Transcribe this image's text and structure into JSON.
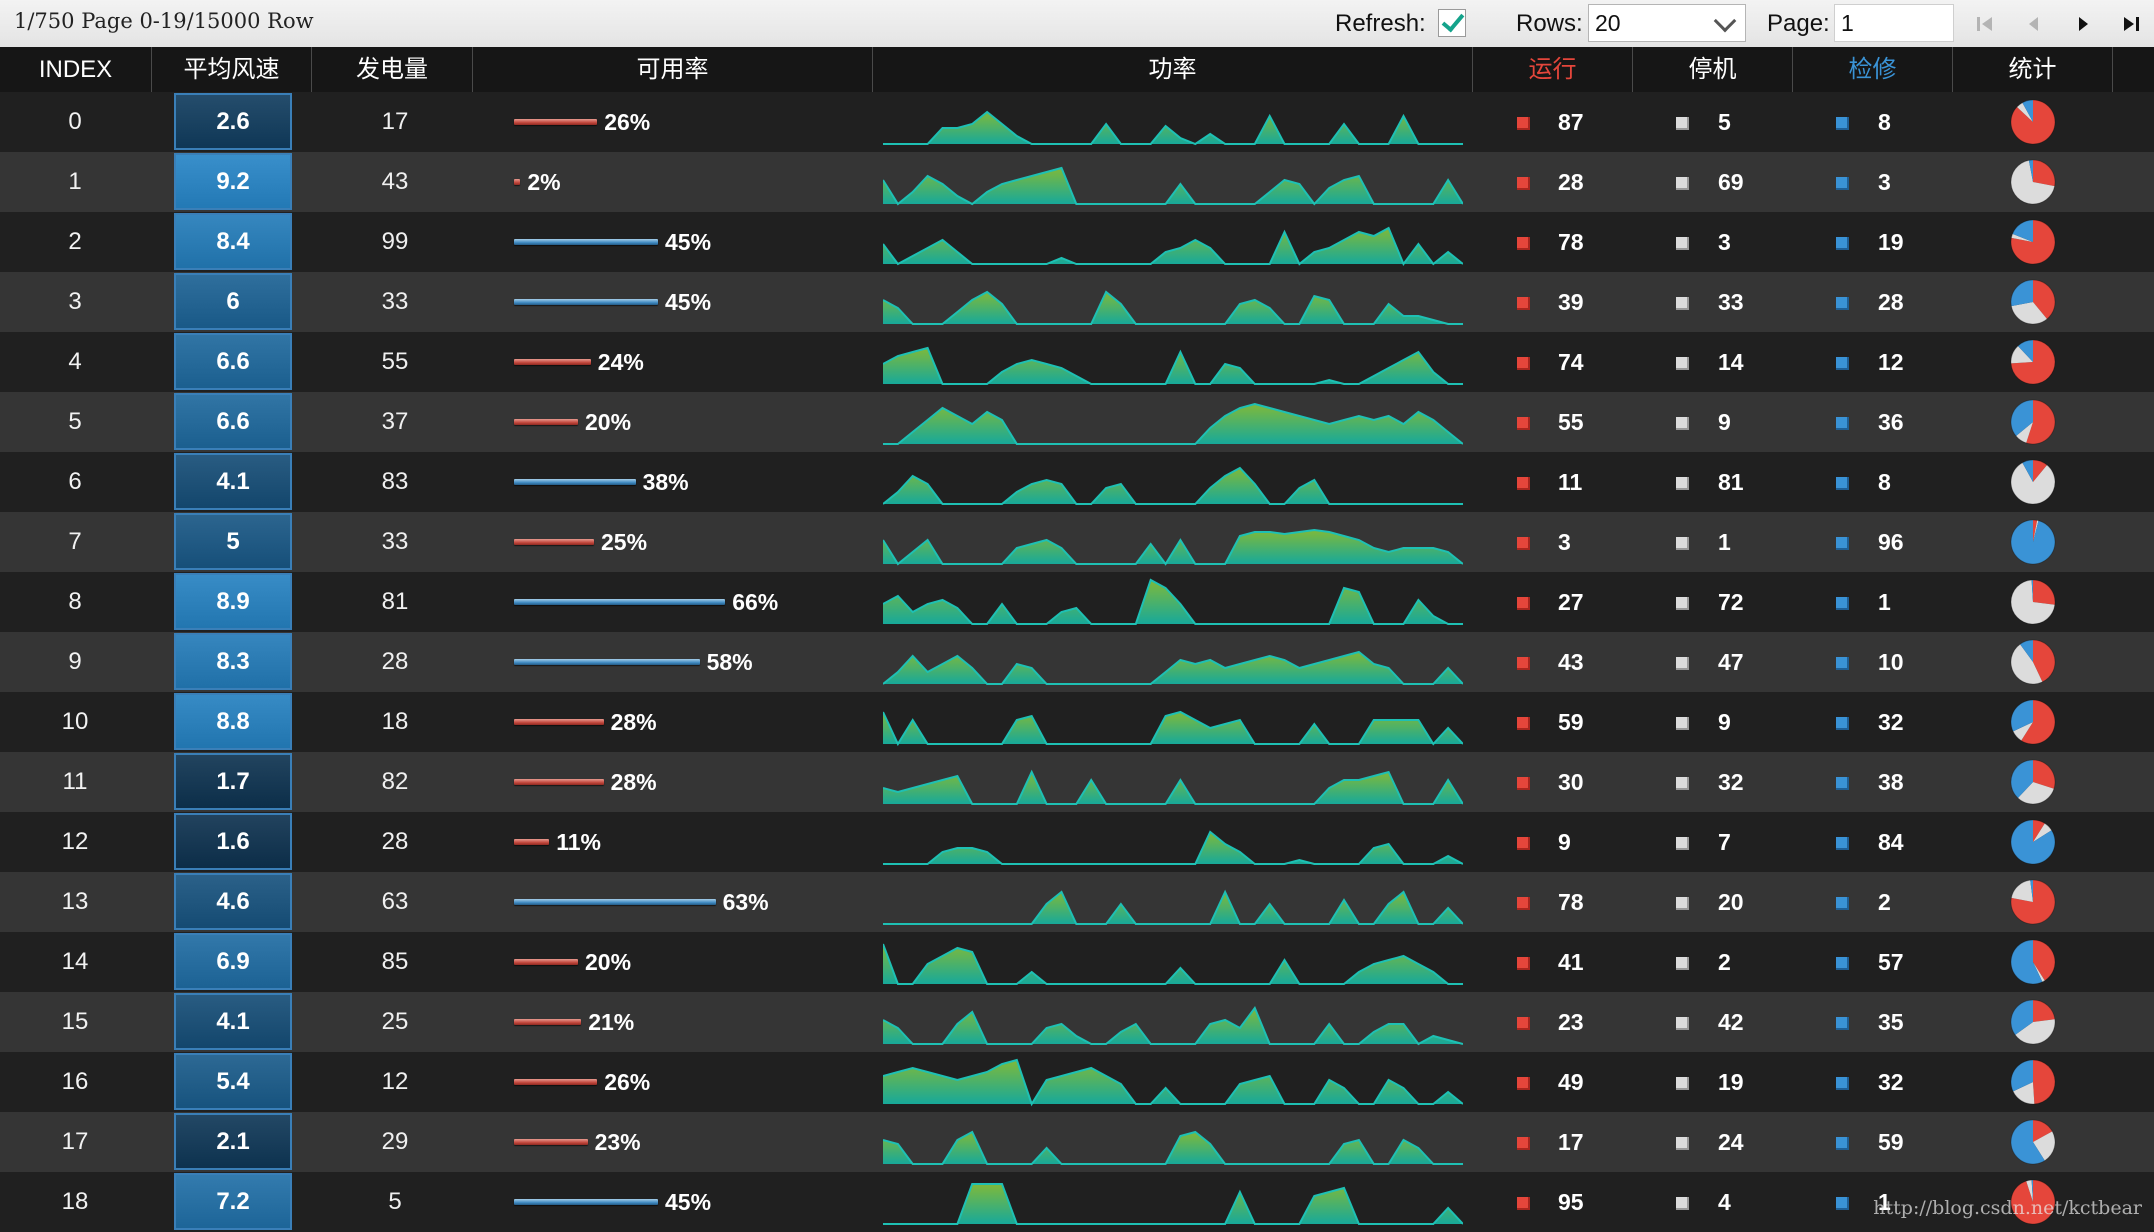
{
  "toolbar": {
    "status": "1/750 Page 0-19/15000 Row",
    "refresh_label": "Refresh:",
    "refresh_checked": true,
    "rows_label": "Rows:",
    "rows_value": "20",
    "page_label": "Page:",
    "page_value": "1",
    "nav_icons": [
      "first-page-icon",
      "previous-page-icon",
      "next-page-icon",
      "last-page-icon"
    ]
  },
  "columns": [
    "INDEX",
    "平均风速",
    "发电量",
    "可用率",
    "功率",
    "运行",
    "停机",
    "检修",
    "统计"
  ],
  "colors": {
    "run": "#e5463b",
    "stop": "#dcdcdc",
    "repair": "#3a93d6",
    "header_run": "#e5463b",
    "header_repair": "#3a93d6",
    "bar_red": "#c2473c",
    "bar_blue": "#3f8ac2",
    "spark_green": "#7fb93a",
    "spark_teal": "#17a99a",
    "wind_dark": "#1d3347",
    "wind_light": "#3b97d6"
  },
  "rows": [
    {
      "index": "0",
      "wind": "2.6",
      "power": "17",
      "avail": 26,
      "avail_color": "red",
      "run": "87",
      "stop": "5",
      "repair": "8",
      "spark": [
        0,
        0,
        0,
        0,
        8,
        8,
        10,
        16,
        10,
        4,
        0,
        0,
        0,
        0,
        0,
        10,
        0,
        0,
        0,
        9,
        3,
        0,
        5,
        0,
        0,
        0,
        14,
        0,
        0,
        0,
        0,
        10,
        0,
        0,
        0,
        14,
        0,
        0,
        0,
        0
      ]
    },
    {
      "index": "1",
      "wind": "9.2",
      "power": "43",
      "avail": 2,
      "avail_color": "red",
      "run": "28",
      "stop": "69",
      "repair": "3",
      "spark": [
        12,
        0,
        6,
        14,
        10,
        4,
        0,
        6,
        10,
        12,
        14,
        16,
        18,
        0,
        0,
        0,
        0,
        0,
        0,
        0,
        10,
        0,
        0,
        0,
        0,
        0,
        6,
        12,
        10,
        0,
        8,
        12,
        14,
        0,
        0,
        0,
        0,
        0,
        12,
        0
      ]
    },
    {
      "index": "2",
      "wind": "8.4",
      "power": "99",
      "avail": 45,
      "avail_color": "blue",
      "run": "78",
      "stop": "3",
      "repair": "19",
      "spark": [
        10,
        0,
        4,
        8,
        12,
        6,
        0,
        0,
        0,
        0,
        0,
        0,
        3,
        0,
        0,
        0,
        0,
        0,
        0,
        6,
        8,
        12,
        8,
        0,
        0,
        0,
        0,
        16,
        0,
        6,
        8,
        12,
        16,
        14,
        18,
        0,
        10,
        0,
        6,
        0
      ]
    },
    {
      "index": "3",
      "wind": "6",
      "power": "33",
      "avail": 45,
      "avail_color": "blue",
      "run": "39",
      "stop": "33",
      "repair": "28",
      "spark": [
        12,
        8,
        0,
        0,
        0,
        6,
        12,
        16,
        10,
        0,
        0,
        0,
        0,
        0,
        0,
        16,
        10,
        0,
        0,
        0,
        0,
        0,
        0,
        0,
        10,
        12,
        8,
        0,
        0,
        14,
        12,
        0,
        0,
        0,
        10,
        4,
        4,
        2,
        0,
        0
      ]
    },
    {
      "index": "4",
      "wind": "6.6",
      "power": "55",
      "avail": 24,
      "avail_color": "red",
      "run": "74",
      "stop": "14",
      "repair": "12",
      "spark": [
        10,
        14,
        16,
        18,
        0,
        0,
        0,
        0,
        6,
        10,
        12,
        10,
        8,
        4,
        0,
        0,
        0,
        0,
        0,
        0,
        16,
        0,
        0,
        10,
        8,
        0,
        0,
        0,
        0,
        0,
        2,
        0,
        0,
        4,
        8,
        12,
        16,
        6,
        0,
        0
      ]
    },
    {
      "index": "5",
      "wind": "6.6",
      "power": "37",
      "avail": 20,
      "avail_color": "red",
      "run": "55",
      "stop": "9",
      "repair": "36",
      "spark": [
        0,
        0,
        6,
        12,
        18,
        14,
        10,
        16,
        12,
        0,
        0,
        0,
        0,
        0,
        0,
        0,
        0,
        0,
        0,
        0,
        0,
        0,
        8,
        14,
        18,
        20,
        18,
        16,
        14,
        12,
        10,
        12,
        14,
        12,
        14,
        10,
        16,
        12,
        6,
        0
      ]
    },
    {
      "index": "6",
      "wind": "4.1",
      "power": "83",
      "avail": 38,
      "avail_color": "blue",
      "run": "11",
      "stop": "81",
      "repair": "8",
      "spark": [
        0,
        6,
        14,
        10,
        0,
        0,
        0,
        0,
        0,
        6,
        10,
        12,
        10,
        0,
        0,
        8,
        10,
        0,
        0,
        0,
        0,
        0,
        8,
        14,
        18,
        10,
        0,
        0,
        8,
        12,
        0,
        0,
        0,
        0,
        0,
        0,
        0,
        0,
        0,
        0
      ]
    },
    {
      "index": "7",
      "wind": "5",
      "power": "33",
      "avail": 25,
      "avail_color": "red",
      "run": "3",
      "stop": "1",
      "repair": "96",
      "spark": [
        12,
        0,
        6,
        12,
        0,
        0,
        0,
        0,
        0,
        8,
        10,
        12,
        8,
        0,
        0,
        0,
        0,
        0,
        10,
        0,
        12,
        0,
        0,
        0,
        14,
        16,
        16,
        15,
        16,
        17,
        16,
        14,
        12,
        8,
        6,
        8,
        8,
        8,
        6,
        0
      ]
    },
    {
      "index": "8",
      "wind": "8.9",
      "power": "81",
      "avail": 66,
      "avail_color": "blue",
      "run": "27",
      "stop": "72",
      "repair": "1",
      "spark": [
        10,
        14,
        6,
        10,
        12,
        8,
        0,
        0,
        10,
        0,
        0,
        0,
        6,
        8,
        0,
        0,
        0,
        0,
        22,
        18,
        10,
        0,
        0,
        0,
        0,
        0,
        0,
        0,
        0,
        0,
        0,
        18,
        16,
        0,
        0,
        0,
        12,
        4,
        0,
        0
      ]
    },
    {
      "index": "9",
      "wind": "8.3",
      "power": "28",
      "avail": 58,
      "avail_color": "blue",
      "run": "43",
      "stop": "47",
      "repair": "10",
      "spark": [
        0,
        6,
        14,
        6,
        10,
        14,
        8,
        0,
        0,
        10,
        8,
        0,
        0,
        0,
        0,
        0,
        0,
        0,
        0,
        6,
        12,
        10,
        12,
        8,
        10,
        12,
        14,
        12,
        8,
        10,
        12,
        14,
        16,
        10,
        8,
        0,
        0,
        0,
        8,
        0
      ]
    },
    {
      "index": "10",
      "wind": "8.8",
      "power": "18",
      "avail": 28,
      "avail_color": "red",
      "run": "59",
      "stop": "9",
      "repair": "32",
      "spark": [
        16,
        0,
        12,
        0,
        0,
        0,
        0,
        0,
        0,
        12,
        14,
        0,
        0,
        0,
        0,
        0,
        0,
        0,
        0,
        14,
        16,
        12,
        8,
        10,
        12,
        0,
        0,
        0,
        0,
        10,
        0,
        0,
        0,
        12,
        12,
        12,
        12,
        0,
        8,
        0
      ]
    },
    {
      "index": "11",
      "wind": "1.7",
      "power": "82",
      "avail": 28,
      "avail_color": "red",
      "run": "30",
      "stop": "32",
      "repair": "38",
      "spark": [
        8,
        6,
        8,
        10,
        12,
        14,
        0,
        0,
        0,
        0,
        16,
        0,
        0,
        0,
        12,
        0,
        0,
        0,
        0,
        0,
        12,
        0,
        0,
        0,
        0,
        0,
        0,
        0,
        0,
        0,
        8,
        12,
        12,
        14,
        16,
        0,
        0,
        0,
        12,
        0
      ]
    },
    {
      "index": "12",
      "wind": "1.6",
      "power": "28",
      "avail": 11,
      "avail_color": "red",
      "run": "9",
      "stop": "7",
      "repair": "84",
      "spark": [
        0,
        0,
        0,
        0,
        6,
        8,
        8,
        6,
        0,
        0,
        0,
        0,
        0,
        0,
        0,
        0,
        0,
        0,
        0,
        0,
        0,
        0,
        16,
        10,
        6,
        0,
        0,
        0,
        2,
        0,
        0,
        0,
        0,
        8,
        10,
        0,
        0,
        0,
        4,
        0
      ]
    },
    {
      "index": "13",
      "wind": "4.6",
      "power": "63",
      "avail": 63,
      "avail_color": "blue",
      "run": "78",
      "stop": "20",
      "repair": "2",
      "spark": [
        0,
        0,
        0,
        0,
        0,
        0,
        0,
        0,
        0,
        0,
        0,
        10,
        16,
        0,
        0,
        0,
        10,
        0,
        0,
        0,
        0,
        0,
        0,
        16,
        0,
        0,
        10,
        0,
        0,
        0,
        0,
        12,
        0,
        0,
        10,
        16,
        0,
        0,
        8,
        0
      ]
    },
    {
      "index": "14",
      "wind": "6.9",
      "power": "85",
      "avail": 20,
      "avail_color": "red",
      "run": "41",
      "stop": "2",
      "repair": "57",
      "spark": [
        20,
        0,
        0,
        10,
        14,
        18,
        16,
        0,
        0,
        0,
        6,
        0,
        0,
        0,
        0,
        0,
        0,
        0,
        0,
        0,
        8,
        0,
        0,
        0,
        0,
        0,
        0,
        12,
        0,
        0,
        0,
        0,
        6,
        10,
        12,
        14,
        10,
        6,
        0,
        0
      ]
    },
    {
      "index": "15",
      "wind": "4.1",
      "power": "25",
      "avail": 21,
      "avail_color": "red",
      "run": "23",
      "stop": "42",
      "repair": "35",
      "spark": [
        12,
        8,
        0,
        0,
        0,
        10,
        16,
        0,
        0,
        0,
        0,
        8,
        10,
        4,
        0,
        0,
        6,
        10,
        0,
        0,
        0,
        0,
        10,
        12,
        8,
        18,
        0,
        0,
        0,
        0,
        10,
        0,
        0,
        6,
        10,
        10,
        0,
        4,
        2,
        0
      ]
    },
    {
      "index": "16",
      "wind": "5.4",
      "power": "12",
      "avail": 26,
      "avail_color": "red",
      "run": "49",
      "stop": "19",
      "repair": "32",
      "spark": [
        14,
        16,
        18,
        16,
        14,
        12,
        14,
        16,
        20,
        22,
        0,
        12,
        14,
        16,
        18,
        14,
        10,
        0,
        0,
        8,
        0,
        0,
        0,
        0,
        10,
        12,
        14,
        0,
        0,
        0,
        12,
        8,
        0,
        0,
        12,
        8,
        0,
        0,
        6,
        0
      ]
    },
    {
      "index": "17",
      "wind": "2.1",
      "power": "29",
      "avail": 23,
      "avail_color": "red",
      "run": "17",
      "stop": "24",
      "repair": "59",
      "spark": [
        12,
        10,
        0,
        0,
        0,
        12,
        16,
        0,
        0,
        0,
        0,
        8,
        0,
        0,
        0,
        0,
        0,
        0,
        0,
        0,
        14,
        16,
        10,
        0,
        0,
        0,
        0,
        0,
        0,
        0,
        0,
        10,
        12,
        0,
        0,
        12,
        8,
        0,
        0,
        0
      ]
    },
    {
      "index": "18",
      "wind": "7.2",
      "power": "5",
      "avail": 45,
      "avail_color": "blue",
      "run": "95",
      "stop": "4",
      "repair": "1",
      "spark": [
        0,
        0,
        0,
        0,
        0,
        0,
        20,
        20,
        20,
        0,
        0,
        0,
        0,
        0,
        0,
        0,
        0,
        0,
        0,
        0,
        0,
        0,
        0,
        0,
        16,
        0,
        0,
        0,
        0,
        14,
        16,
        18,
        0,
        0,
        0,
        0,
        0,
        0,
        8,
        0
      ]
    }
  ],
  "watermark": "http://blog.csdn.net/kctbear"
}
